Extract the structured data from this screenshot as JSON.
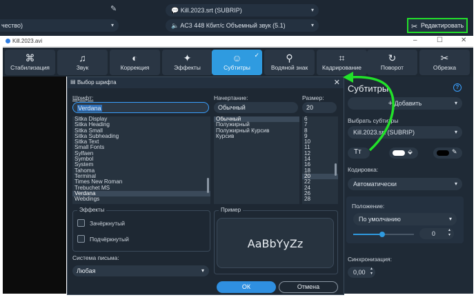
{
  "top": {
    "left_combo_value": "чество)",
    "subtitle_track": "Kill.2023.srt (SUBRIP)",
    "audio_track": "AC3 448 Кбит/с Объемный звук (5.1)",
    "edit_button": "Редактировать"
  },
  "window": {
    "title": "Kill.2023.avi"
  },
  "toolbar": {
    "tabs": [
      {
        "label": "Стабилизация",
        "icon": "stabilization-icon"
      },
      {
        "label": "Звук",
        "icon": "music-note-icon"
      },
      {
        "label": "Коррекция",
        "icon": "color-correction-icon"
      },
      {
        "label": "Эффекты",
        "icon": "magic-wand-icon"
      },
      {
        "label": "Субтитры",
        "icon": "speech-bubble-icon",
        "active": true
      },
      {
        "label": "Водяной знак",
        "icon": "stamp-icon"
      },
      {
        "label": "Кадрирование",
        "icon": "crop-icon"
      },
      {
        "label": "Поворот",
        "icon": "rotate-icon"
      },
      {
        "label": "Обрезка",
        "icon": "scissors-icon"
      }
    ]
  },
  "right_panel": {
    "title": "Субтитры",
    "add_button": "Добавить",
    "select_label": "Выбрать субтитры",
    "select_value": "Kill.2023.srt (SUBRIP)",
    "encoding_label": "Кодировка:",
    "encoding_value": "Автоматически",
    "position_label": "Положение:",
    "position_value": "По умолчанию",
    "position_number": "0",
    "sync_label": "Синхронизация:",
    "sync_value": "0,00",
    "slider_fraction": 0.48
  },
  "dialog": {
    "title": "Выбор шрифта",
    "font_label": "Шрифт:",
    "font_value": "Verdana",
    "style_label": "Начертание:",
    "style_value": "Обычный",
    "size_label": "Размер:",
    "size_value": "20",
    "fonts": [
      "Sitka Display",
      "Sitka Heading",
      "Sitka Small",
      "Sitka Subheading",
      "Sitka Text",
      "Small Fonts",
      "Sylfaen",
      "Symbol",
      "System",
      "Tahoma",
      "Terminal",
      "Times New Roman",
      "Trebuchet MS",
      "Verdana",
      "Webdings"
    ],
    "selected_font": "Verdana",
    "styles": [
      "Обычный",
      "Полужирный",
      "Полужирный Курсив",
      "Курсив"
    ],
    "selected_style": "Обычный",
    "sizes": [
      "6",
      "7",
      "8",
      "9",
      "10",
      "11",
      "12",
      "14",
      "16",
      "18",
      "20",
      "22",
      "24",
      "26",
      "28"
    ],
    "selected_size": "20",
    "effects_label": "Эффекты",
    "strikeout_label": "Зачёркнутый",
    "underline_label": "Подчёркнутый",
    "sample_label": "Пример",
    "sample_text": "AaBbYyZz",
    "script_label": "Система письма:",
    "script_value": "Любая",
    "ok_button": "ОК",
    "cancel_button": "Отмена"
  },
  "colors": {
    "accent": "#2f9be0",
    "highlight_border": "#22e12a",
    "arrow": "#22e12a",
    "panel_bg": "#1f2a36"
  }
}
